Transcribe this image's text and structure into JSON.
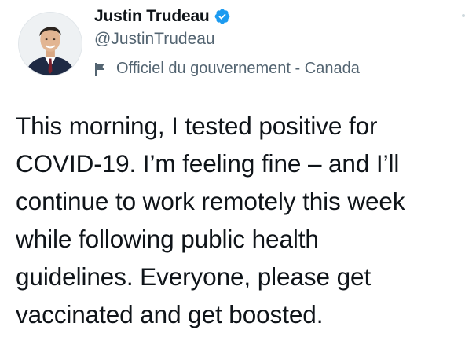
{
  "author": {
    "display_name": "Justin Trudeau",
    "handle": "@JustinTrudeau",
    "verified": true,
    "avatar_icon": "profile-photo",
    "verified_icon": "verified-badge-icon",
    "verified_color": "#1d9bf0"
  },
  "account_label": {
    "icon": "flag-icon",
    "text": "Officiel du gouvernement - Canada"
  },
  "tweet": {
    "text": "This morning, I tested positive for\nCOVID-19. I’m feeling fine – and I’ll\ncontinue to work remotely this week\nwhile following public health\nguidelines. Everyone, please get\nvaccinated and get boosted."
  },
  "colors": {
    "text_primary": "#0f1419",
    "text_secondary": "#536471",
    "accent": "#1d9bf0"
  }
}
